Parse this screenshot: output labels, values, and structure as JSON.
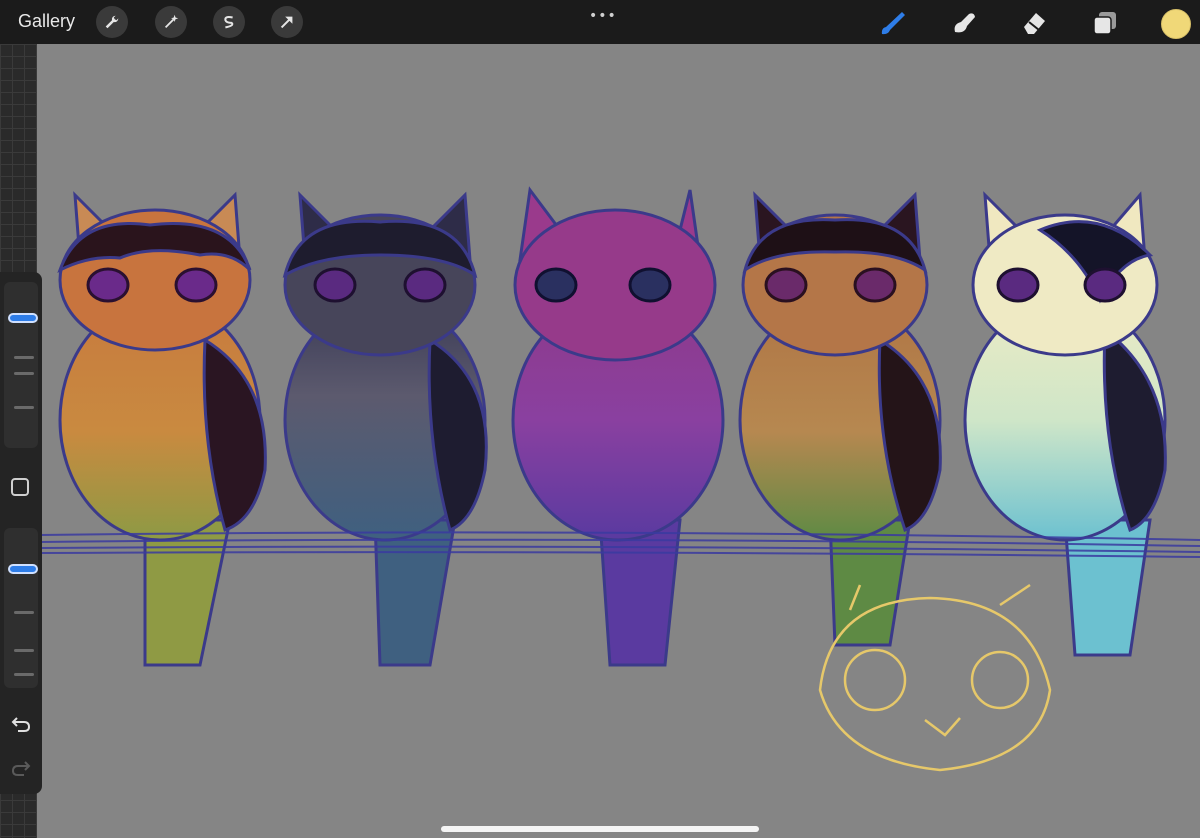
{
  "app": {
    "gallery_label": "Gallery",
    "more_label": "•••"
  },
  "toolbar_left": [
    {
      "name": "actions",
      "icon": "wrench-icon"
    },
    {
      "name": "adjustments",
      "icon": "magic-wand-icon"
    },
    {
      "name": "selection",
      "icon": "selection-s-icon"
    },
    {
      "name": "transform",
      "icon": "arrow-cursor-icon"
    }
  ],
  "toolbar_right": [
    {
      "name": "brush",
      "icon": "brush-icon",
      "active": true
    },
    {
      "name": "smudge",
      "icon": "smudge-icon",
      "active": false
    },
    {
      "name": "eraser",
      "icon": "eraser-icon",
      "active": false
    },
    {
      "name": "layers",
      "icon": "layers-icon",
      "active": false
    }
  ],
  "current_color": "#f0d878",
  "sidebar": {
    "brush_size_level": 0.95,
    "opacity_level": 0.98,
    "undo_icon": "undo-icon",
    "redo_icon": "redo-icon",
    "modifier_icon": "square-modifier-icon"
  },
  "colors": {
    "topbar": "#1b1b1b",
    "canvas": "#858585",
    "accent": "#2e7de8"
  }
}
